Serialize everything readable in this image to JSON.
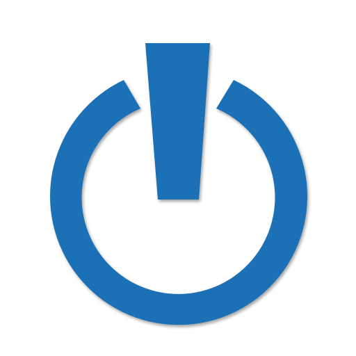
{
  "icon": {
    "name": "power-icon",
    "color": "#1a6fb5",
    "shadow_color": "#00000033"
  }
}
